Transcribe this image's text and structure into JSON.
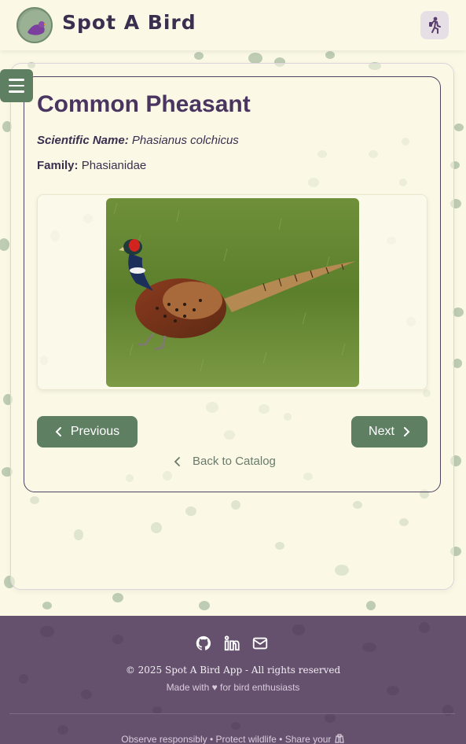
{
  "header": {
    "brand": "Spot A Bird",
    "logo_text": "Spot A Bird"
  },
  "bird": {
    "name": "Common Pheasant",
    "scientific_label": "Scientific Name:",
    "scientific_name": "Phasianus colchicus",
    "family_label": "Family:",
    "family": "Phasianidae"
  },
  "nav": {
    "previous_label": "Previous",
    "next_label": "Next",
    "back_label": "Back to Catalog"
  },
  "footer": {
    "copyright": "© 2025 Spot A Bird App - All rights reserved",
    "made_with": "Made with ♥ for bird enthusiasts",
    "observe": "Observe responsibly • Protect wildlife • Share your"
  },
  "colors": {
    "background": "#fbf9e6",
    "accent_green": "#5f7f63",
    "title_purple": "#4a3560",
    "footer_purple": "#65506e"
  }
}
